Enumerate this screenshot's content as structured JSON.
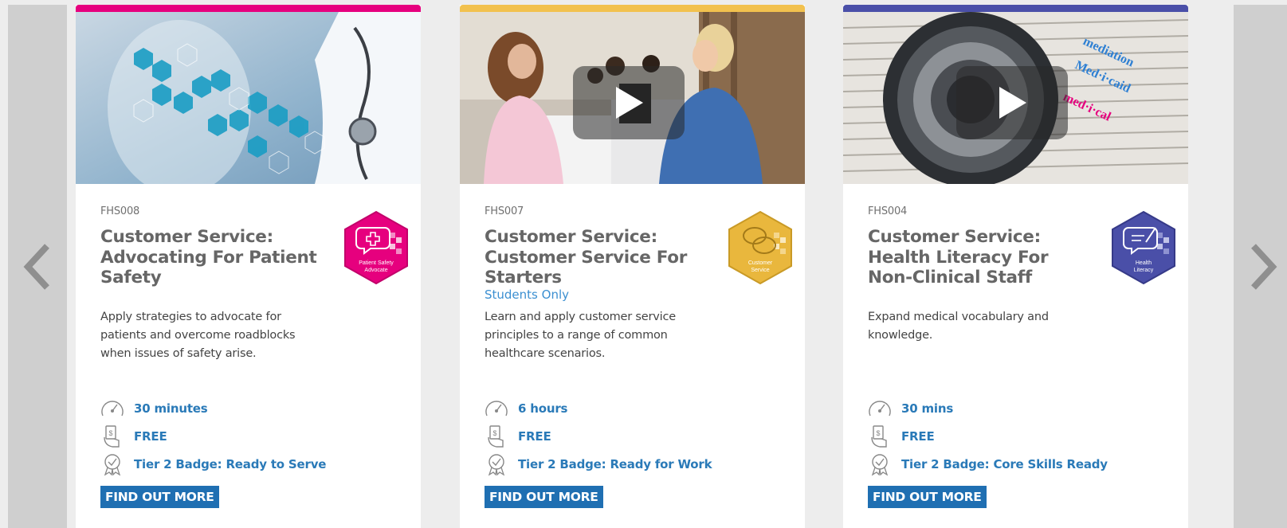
{
  "colors": {
    "card1_accent": "#e6007e",
    "card2_accent": "#f2c14e",
    "card3_accent": "#4a4fa8",
    "link": "#2a7ab8",
    "button": "#1f6fb2"
  },
  "cards": [
    {
      "code": "FHS008",
      "title": "Customer Service: Advocating For Patient Safety",
      "subtitle": "",
      "badge_label_1": "Patient Safety",
      "badge_label_2": "Advocate",
      "description": "Apply strategies to advocate for patients and overcome roadblocks when issues of safety arise.",
      "duration": "30 minutes",
      "price": "FREE",
      "badge_tier": "Tier 2 Badge: Ready to Serve",
      "cta": "FIND OUT MORE"
    },
    {
      "code": "FHS007",
      "title": "Customer Service: Customer Service For Starters",
      "subtitle": "Students Only",
      "badge_label_1": "Customer",
      "badge_label_2": "Service",
      "description": "Learn and apply customer service principles to a range of common healthcare scenarios.",
      "duration": "6 hours",
      "price": "FREE",
      "badge_tier": "Tier 2 Badge: Ready for Work",
      "cta": "FIND OUT MORE"
    },
    {
      "code": "FHS004",
      "title": "Customer Service: Health Literacy For Non-Clinical Staff",
      "subtitle": "",
      "badge_label_1": "Health",
      "badge_label_2": "Literacy",
      "description": "Expand medical vocabulary and knowledge.",
      "duration": "30 mins",
      "price": "FREE",
      "badge_tier": "Tier 2 Badge: Core Skills Ready",
      "cta": "FIND OUT MORE"
    }
  ],
  "icons": {
    "prev": "chevron-left-icon",
    "next": "chevron-right-icon",
    "duration": "speedometer-icon",
    "price": "price-tag-hand-icon",
    "badge": "award-ribbon-icon",
    "play": "play-icon"
  }
}
